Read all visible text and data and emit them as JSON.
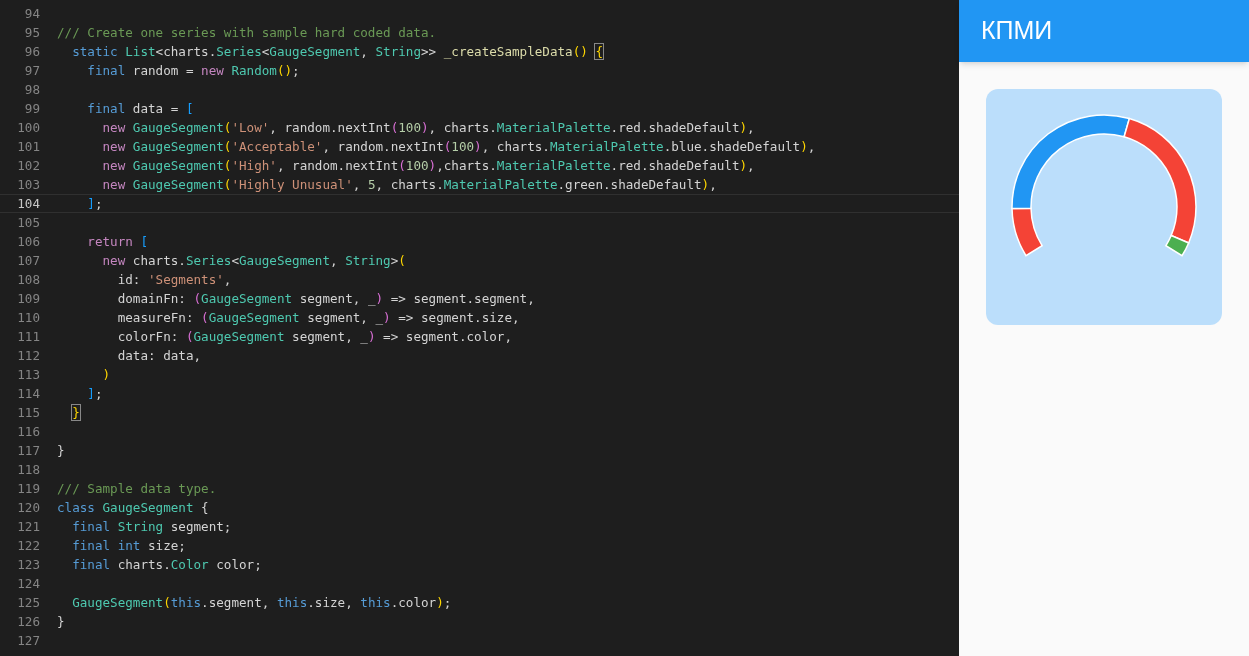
{
  "editor": {
    "lines": [
      {
        "number": "94",
        "current": false
      },
      {
        "number": "95",
        "current": false,
        "tokens": [
          {
            "text": "/// Create one series with sample hard coded data.",
            "kind": "comment"
          }
        ]
      },
      {
        "number": "96",
        "current": false,
        "tokens": [
          {
            "text": "  static ",
            "kind": "keyword"
          },
          {
            "text": "List",
            "kind": "type"
          },
          {
            "text": "<charts.",
            "kind": "plain"
          },
          {
            "text": "Series",
            "kind": "type"
          },
          {
            "text": "<",
            "kind": "plain"
          },
          {
            "text": "GaugeSegment",
            "kind": "type"
          },
          {
            "text": ", ",
            "kind": "plain"
          },
          {
            "text": "String",
            "kind": "type"
          },
          {
            "text": ">> ",
            "kind": "plain"
          },
          {
            "text": "_createSampleData",
            "kind": "func"
          },
          {
            "text": "() ",
            "kind": "bracket1"
          },
          {
            "text": "{",
            "kind": "match"
          }
        ]
      },
      {
        "number": "97",
        "current": false,
        "tokens": [
          {
            "text": "    final",
            "kind": "keyword"
          },
          {
            "text": " random = ",
            "kind": "plain"
          },
          {
            "text": "new ",
            "kind": "control"
          },
          {
            "text": "Random",
            "kind": "type"
          },
          {
            "text": "()",
            "kind": "bracket1"
          },
          {
            "text": ";",
            "kind": "plain"
          }
        ]
      },
      {
        "number": "98",
        "current": false
      },
      {
        "number": "99",
        "current": false,
        "tokens": [
          {
            "text": "    final",
            "kind": "keyword"
          },
          {
            "text": " data = ",
            "kind": "plain"
          },
          {
            "text": "[",
            "kind": "bracket3"
          }
        ]
      },
      {
        "number": "100",
        "current": false,
        "tokens": [
          {
            "text": "      new ",
            "kind": "control"
          },
          {
            "text": "GaugeSegment",
            "kind": "type"
          },
          {
            "text": "(",
            "kind": "bracket1"
          },
          {
            "text": "'Low'",
            "kind": "string"
          },
          {
            "text": ", random.nextInt",
            "kind": "plain"
          },
          {
            "text": "(",
            "kind": "bracket2"
          },
          {
            "text": "100",
            "kind": "number"
          },
          {
            "text": ")",
            "kind": "bracket2"
          },
          {
            "text": ", charts.",
            "kind": "plain"
          },
          {
            "text": "MaterialPalette",
            "kind": "type"
          },
          {
            "text": ".red.shadeDefault",
            "kind": "plain"
          },
          {
            "text": ")",
            "kind": "bracket1"
          },
          {
            "text": ",",
            "kind": "plain"
          }
        ]
      },
      {
        "number": "101",
        "current": false,
        "tokens": [
          {
            "text": "      new ",
            "kind": "control"
          },
          {
            "text": "GaugeSegment",
            "kind": "type"
          },
          {
            "text": "(",
            "kind": "bracket1"
          },
          {
            "text": "'Acceptable'",
            "kind": "string"
          },
          {
            "text": ", random.nextInt",
            "kind": "plain"
          },
          {
            "text": "(",
            "kind": "bracket2"
          },
          {
            "text": "100",
            "kind": "number"
          },
          {
            "text": ")",
            "kind": "bracket2"
          },
          {
            "text": ", charts.",
            "kind": "plain"
          },
          {
            "text": "MaterialPalette",
            "kind": "type"
          },
          {
            "text": ".blue.shadeDefault",
            "kind": "plain"
          },
          {
            "text": ")",
            "kind": "bracket1"
          },
          {
            "text": ",",
            "kind": "plain"
          }
        ]
      },
      {
        "number": "102",
        "current": false,
        "tokens": [
          {
            "text": "      new ",
            "kind": "control"
          },
          {
            "text": "GaugeSegment",
            "kind": "type"
          },
          {
            "text": "(",
            "kind": "bracket1"
          },
          {
            "text": "'High'",
            "kind": "string"
          },
          {
            "text": ", random.nextInt",
            "kind": "plain"
          },
          {
            "text": "(",
            "kind": "bracket2"
          },
          {
            "text": "100",
            "kind": "number"
          },
          {
            "text": ")",
            "kind": "bracket2"
          },
          {
            "text": ",charts.",
            "kind": "plain"
          },
          {
            "text": "MaterialPalette",
            "kind": "type"
          },
          {
            "text": ".red.shadeDefault",
            "kind": "plain"
          },
          {
            "text": ")",
            "kind": "bracket1"
          },
          {
            "text": ",",
            "kind": "plain"
          }
        ]
      },
      {
        "number": "103",
        "current": false,
        "tokens": [
          {
            "text": "      new ",
            "kind": "control"
          },
          {
            "text": "GaugeSegment",
            "kind": "type"
          },
          {
            "text": "(",
            "kind": "bracket1"
          },
          {
            "text": "'Highly Unusual'",
            "kind": "string"
          },
          {
            "text": ", ",
            "kind": "plain"
          },
          {
            "text": "5",
            "kind": "number"
          },
          {
            "text": ", charts.",
            "kind": "plain"
          },
          {
            "text": "MaterialPalette",
            "kind": "type"
          },
          {
            "text": ".green.shadeDefault",
            "kind": "plain"
          },
          {
            "text": ")",
            "kind": "bracket1"
          },
          {
            "text": ",",
            "kind": "plain"
          }
        ]
      },
      {
        "number": "104",
        "current": true,
        "tokens": [
          {
            "text": "    ]",
            "kind": "bracket3"
          },
          {
            "text": ";",
            "kind": "plain"
          }
        ]
      },
      {
        "number": "105",
        "current": false
      },
      {
        "number": "106",
        "current": false,
        "tokens": [
          {
            "text": "    return ",
            "kind": "control"
          },
          {
            "text": "[",
            "kind": "bracket3"
          }
        ]
      },
      {
        "number": "107",
        "current": false,
        "tokens": [
          {
            "text": "      new",
            "kind": "control"
          },
          {
            "text": " charts.",
            "kind": "plain"
          },
          {
            "text": "Series",
            "kind": "type"
          },
          {
            "text": "<",
            "kind": "plain"
          },
          {
            "text": "GaugeSegment",
            "kind": "type"
          },
          {
            "text": ", ",
            "kind": "plain"
          },
          {
            "text": "String",
            "kind": "type"
          },
          {
            "text": ">",
            "kind": "plain"
          },
          {
            "text": "(",
            "kind": "bracket1"
          }
        ]
      },
      {
        "number": "108",
        "current": false,
        "tokens": [
          {
            "text": "        id: ",
            "kind": "plain"
          },
          {
            "text": "'Segments'",
            "kind": "string"
          },
          {
            "text": ",",
            "kind": "plain"
          }
        ]
      },
      {
        "number": "109",
        "current": false,
        "tokens": [
          {
            "text": "        domainFn: ",
            "kind": "plain"
          },
          {
            "text": "(",
            "kind": "bracket2"
          },
          {
            "text": "GaugeSegment",
            "kind": "type"
          },
          {
            "text": " segment, _",
            "kind": "plain"
          },
          {
            "text": ")",
            "kind": "bracket2"
          },
          {
            "text": " => segment.segment,",
            "kind": "plain"
          }
        ]
      },
      {
        "number": "110",
        "current": false,
        "tokens": [
          {
            "text": "        measureFn: ",
            "kind": "plain"
          },
          {
            "text": "(",
            "kind": "bracket2"
          },
          {
            "text": "GaugeSegment",
            "kind": "type"
          },
          {
            "text": " segment, _",
            "kind": "plain"
          },
          {
            "text": ")",
            "kind": "bracket2"
          },
          {
            "text": " => segment.size,",
            "kind": "plain"
          }
        ]
      },
      {
        "number": "111",
        "current": false,
        "tokens": [
          {
            "text": "        colorFn: ",
            "kind": "plain"
          },
          {
            "text": "(",
            "kind": "bracket2"
          },
          {
            "text": "GaugeSegment",
            "kind": "type"
          },
          {
            "text": " segment, _",
            "kind": "plain"
          },
          {
            "text": ")",
            "kind": "bracket2"
          },
          {
            "text": " => segment.color,",
            "kind": "plain"
          }
        ]
      },
      {
        "number": "112",
        "current": false,
        "tokens": [
          {
            "text": "        data: data,",
            "kind": "plain"
          }
        ]
      },
      {
        "number": "113",
        "current": false,
        "tokens": [
          {
            "text": "      )",
            "kind": "bracket1"
          }
        ]
      },
      {
        "number": "114",
        "current": false,
        "tokens": [
          {
            "text": "    ]",
            "kind": "bracket3"
          },
          {
            "text": ";",
            "kind": "plain"
          }
        ]
      },
      {
        "number": "115",
        "current": false,
        "tokens": [
          {
            "text": "  }",
            "kind": "match"
          }
        ]
      },
      {
        "number": "116",
        "current": false
      },
      {
        "number": "117",
        "current": false,
        "tokens": [
          {
            "text": "}",
            "kind": "plain"
          }
        ]
      },
      {
        "number": "118",
        "current": false
      },
      {
        "number": "119",
        "current": false,
        "tokens": [
          {
            "text": "/// Sample data type.",
            "kind": "comment"
          }
        ]
      },
      {
        "number": "120",
        "current": false,
        "tokens": [
          {
            "text": "class ",
            "kind": "keyword"
          },
          {
            "text": "GaugeSegment",
            "kind": "type"
          },
          {
            "text": " {",
            "kind": "plain"
          }
        ]
      },
      {
        "number": "121",
        "current": false,
        "tokens": [
          {
            "text": "  final ",
            "kind": "keyword"
          },
          {
            "text": "String",
            "kind": "type"
          },
          {
            "text": " segment;",
            "kind": "plain"
          }
        ]
      },
      {
        "number": "122",
        "current": false,
        "tokens": [
          {
            "text": "  final int",
            "kind": "keyword"
          },
          {
            "text": " size;",
            "kind": "plain"
          }
        ]
      },
      {
        "number": "123",
        "current": false,
        "tokens": [
          {
            "text": "  final",
            "kind": "keyword"
          },
          {
            "text": " charts.",
            "kind": "plain"
          },
          {
            "text": "Color",
            "kind": "type"
          },
          {
            "text": " color;",
            "kind": "plain"
          }
        ]
      },
      {
        "number": "124",
        "current": false
      },
      {
        "number": "125",
        "current": false,
        "tokens": [
          {
            "text": "  GaugeSegment",
            "kind": "type"
          },
          {
            "text": "(",
            "kind": "bracket1"
          },
          {
            "text": "this",
            "kind": "keyword"
          },
          {
            "text": ".segment, ",
            "kind": "plain"
          },
          {
            "text": "this",
            "kind": "keyword"
          },
          {
            "text": ".size, ",
            "kind": "plain"
          },
          {
            "text": "this",
            "kind": "keyword"
          },
          {
            "text": ".color",
            "kind": "plain"
          },
          {
            "text": ")",
            "kind": "bracket1"
          },
          {
            "text": ";",
            "kind": "plain"
          }
        ]
      },
      {
        "number": "126",
        "current": false,
        "tokens": [
          {
            "text": "}",
            "kind": "plain"
          }
        ]
      },
      {
        "number": "127",
        "current": false
      }
    ]
  },
  "app": {
    "title": "КПМИ"
  }
}
